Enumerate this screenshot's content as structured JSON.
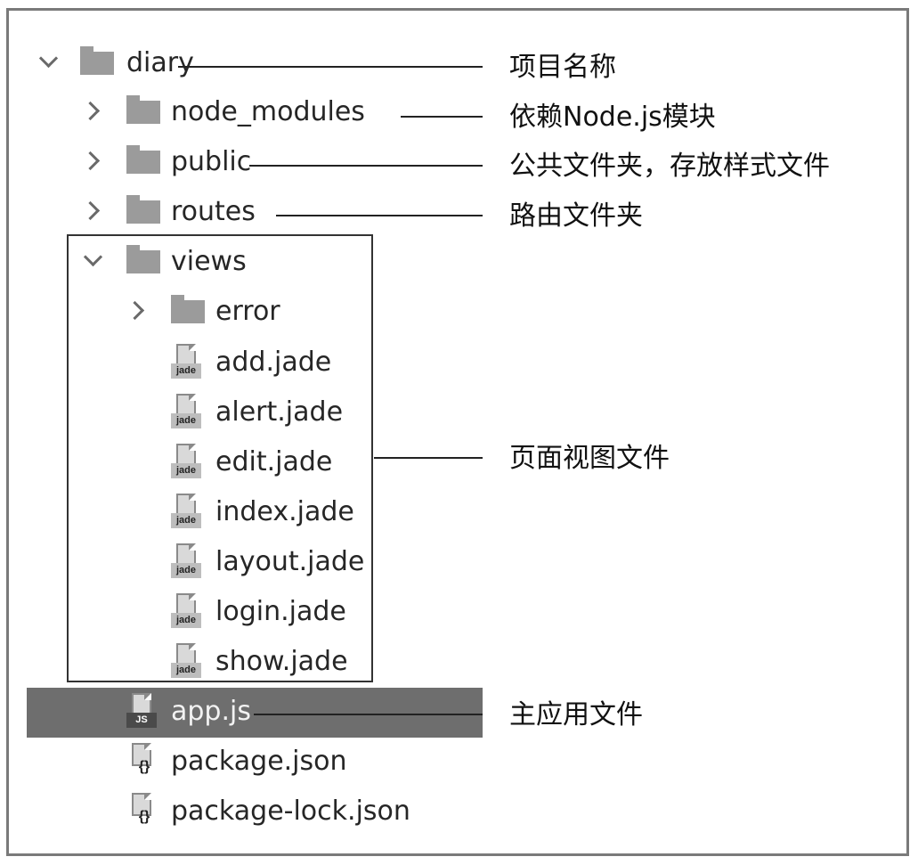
{
  "tree": {
    "items": [
      {
        "label": "diary",
        "kind": "folder",
        "expand": "down"
      },
      {
        "label": "node_modules",
        "kind": "folder",
        "expand": "right"
      },
      {
        "label": "public",
        "kind": "folder",
        "expand": "right"
      },
      {
        "label": "routes",
        "kind": "folder",
        "expand": "right"
      },
      {
        "label": "views",
        "kind": "folder",
        "expand": "down"
      },
      {
        "label": "error",
        "kind": "folder",
        "expand": "right"
      },
      {
        "label": "add.jade",
        "kind": "jade"
      },
      {
        "label": "alert.jade",
        "kind": "jade"
      },
      {
        "label": "edit.jade",
        "kind": "jade"
      },
      {
        "label": "index.jade",
        "kind": "jade"
      },
      {
        "label": "layout.jade",
        "kind": "jade"
      },
      {
        "label": "login.jade",
        "kind": "jade"
      },
      {
        "label": "show.jade",
        "kind": "jade"
      },
      {
        "label": "app.js",
        "kind": "js",
        "selected": true
      },
      {
        "label": "package.json",
        "kind": "json"
      },
      {
        "label": "package-lock.json",
        "kind": "json"
      }
    ],
    "icon_tags": {
      "jade": "jade",
      "js": "JS",
      "json": "{}"
    }
  },
  "annotations": {
    "project_name": "项目名称",
    "node_modules": "依赖Node.js模块",
    "public": "公共文件夹，存放样式文件",
    "routes": "路由文件夹",
    "views": "页面视图文件",
    "app": "主应用文件"
  },
  "colors": {
    "selected_bg": "#6e6e6e",
    "folder": "#9b9b9b"
  }
}
